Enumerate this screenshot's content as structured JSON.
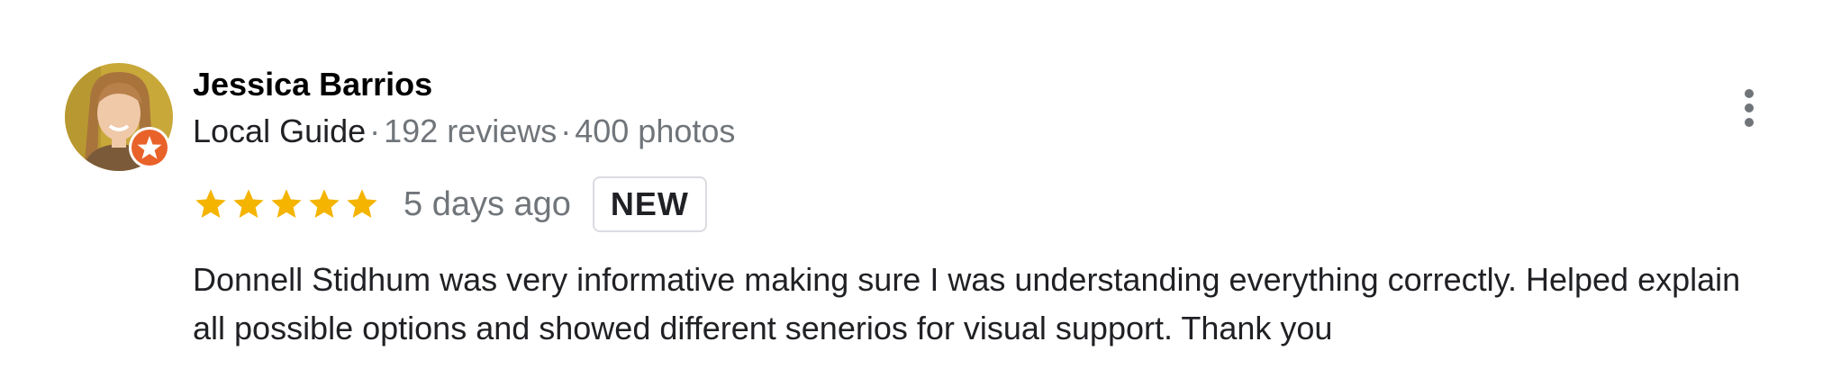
{
  "review": {
    "author": "Jessica Barrios",
    "badge": "Local Guide",
    "separator": "·",
    "reviews_count": "192 reviews",
    "photos_count": "400 photos",
    "rating": 5,
    "rating_max": 5,
    "date": "5 days ago",
    "new_label": "NEW",
    "text": "Donnell Stidhum was very informative making sure I was understanding everything correctly. Helped explain all possible options and showed different senerios for visual support. Thank you"
  },
  "icons": {
    "star": "star-icon",
    "more": "more-vert-icon",
    "guide_badge": "local-guide-badge-icon"
  },
  "colors": {
    "star": "#f4b400",
    "guide_badge": "#e8622a",
    "muted_text": "#70757a",
    "text": "#202124"
  }
}
